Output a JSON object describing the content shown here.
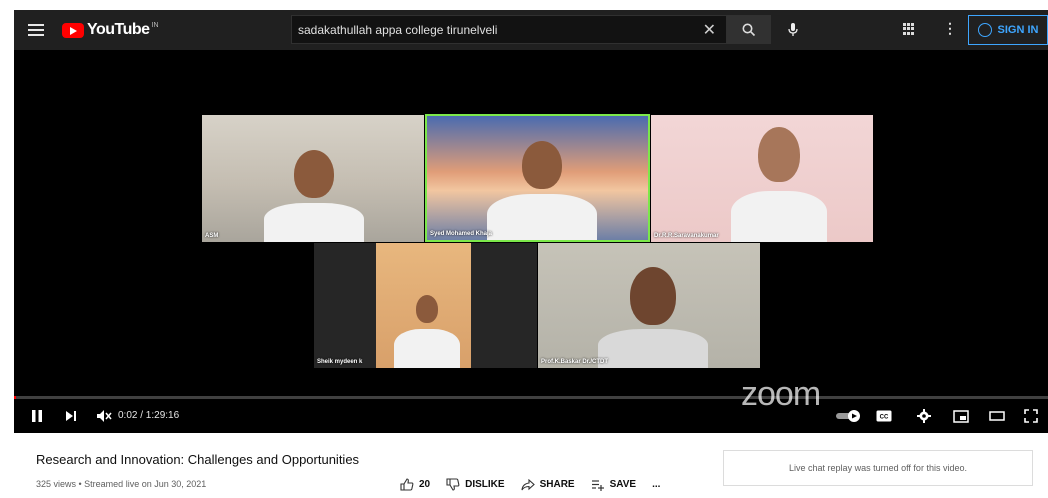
{
  "header": {
    "logo_text": "YouTube",
    "logo_country": "IN",
    "search_value": "sadakathullah appa college tirunelveli",
    "signin_label": "SIGN IN"
  },
  "player": {
    "participants": [
      {
        "label": "ASM"
      },
      {
        "label": "Syed Mohamed Khaja"
      },
      {
        "label": "Dr.R.R.Saravanakumar"
      },
      {
        "label": "Sheik mydeen k"
      },
      {
        "label": "Prof.K.Baskar Dr./CTDT"
      }
    ],
    "watermark": "zoom",
    "time_display": "0:02 / 1:29:16",
    "progress": 0.0004,
    "icons": [
      "pause-icon",
      "next-icon",
      "mute-icon",
      "autoplay-toggle",
      "cc-icon",
      "settings-icon",
      "miniplayer-icon",
      "theater-icon",
      "fullscreen-icon"
    ]
  },
  "video": {
    "title": "Research and Innovation: Challenges and Opportunities",
    "meta": "325 views • Streamed live on Jun 30, 2021",
    "likes": "20",
    "dislike_label": "DISLIKE",
    "share_label": "SHARE",
    "save_label": "SAVE",
    "more_label": "..."
  },
  "chat": {
    "message": "Live chat replay was turned off for this video."
  },
  "colors": {
    "brand_red": "#ff0000",
    "signin_blue": "#3ea6ff",
    "active_speaker": "#7ce84a"
  }
}
